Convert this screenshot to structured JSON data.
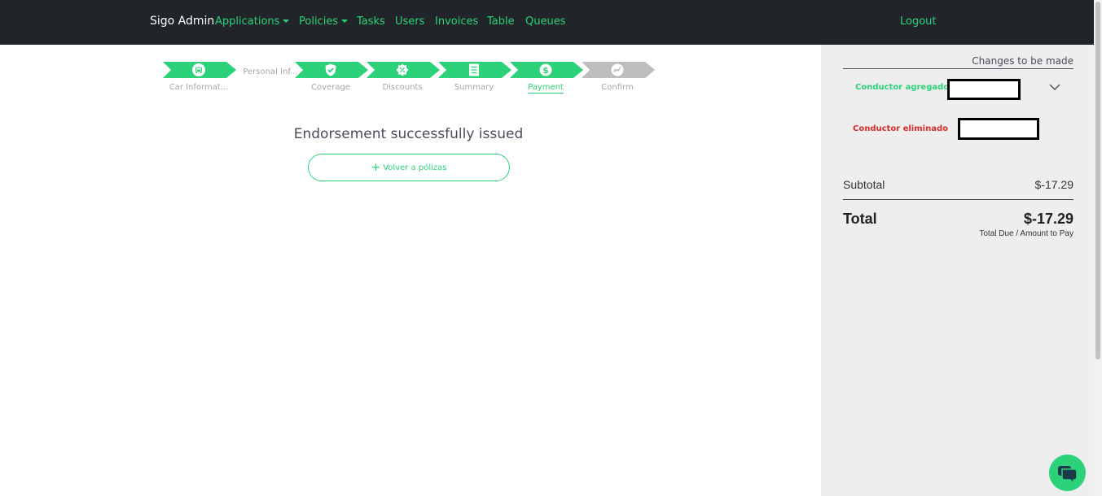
{
  "navbar": {
    "brand": "Sigo Admin",
    "items": [
      {
        "label": "Applications",
        "dropdown": true
      },
      {
        "label": "Policies",
        "dropdown": true
      },
      {
        "label": "Tasks",
        "dropdown": false
      },
      {
        "label": "Users",
        "dropdown": false
      },
      {
        "label": "Invoices",
        "dropdown": false
      },
      {
        "label": "Table",
        "dropdown": false
      },
      {
        "label": "Queues",
        "dropdown": false
      }
    ],
    "logout": "Logout"
  },
  "stepper": {
    "steps": [
      {
        "label": "Car Informat...",
        "icon": "car-icon",
        "state": "complete"
      },
      {
        "label": "Personal Inf...",
        "icon": "",
        "state": "current-inline"
      },
      {
        "label": "Coverage",
        "icon": "shield-check-icon",
        "state": "complete"
      },
      {
        "label": "Discounts",
        "icon": "percent-badge-icon",
        "state": "complete"
      },
      {
        "label": "Summary",
        "icon": "list-icon",
        "state": "complete"
      },
      {
        "label": "Payment",
        "icon": "dollar-icon",
        "state": "active"
      },
      {
        "label": "Confirm",
        "icon": "signature-icon",
        "state": "pending"
      }
    ]
  },
  "main": {
    "success_title": "Endorsement successfully issued",
    "back_button": "Volver a pólizas"
  },
  "side_panel": {
    "title": "Changes to be made",
    "added_label": "Conductor agregado",
    "removed_label": "Conductor eliminado",
    "subtotal_label": "Subtotal",
    "subtotal_value": "$-17.29",
    "total_label": "Total",
    "total_value": "$-17.29",
    "total_note": "Total Due / Amount to Pay"
  },
  "colors": {
    "accent": "#2bd27a",
    "navbar_bg": "#212529",
    "panel_bg": "#eeeeee",
    "danger": "#d92b2b",
    "pending": "#bdbdbd"
  }
}
